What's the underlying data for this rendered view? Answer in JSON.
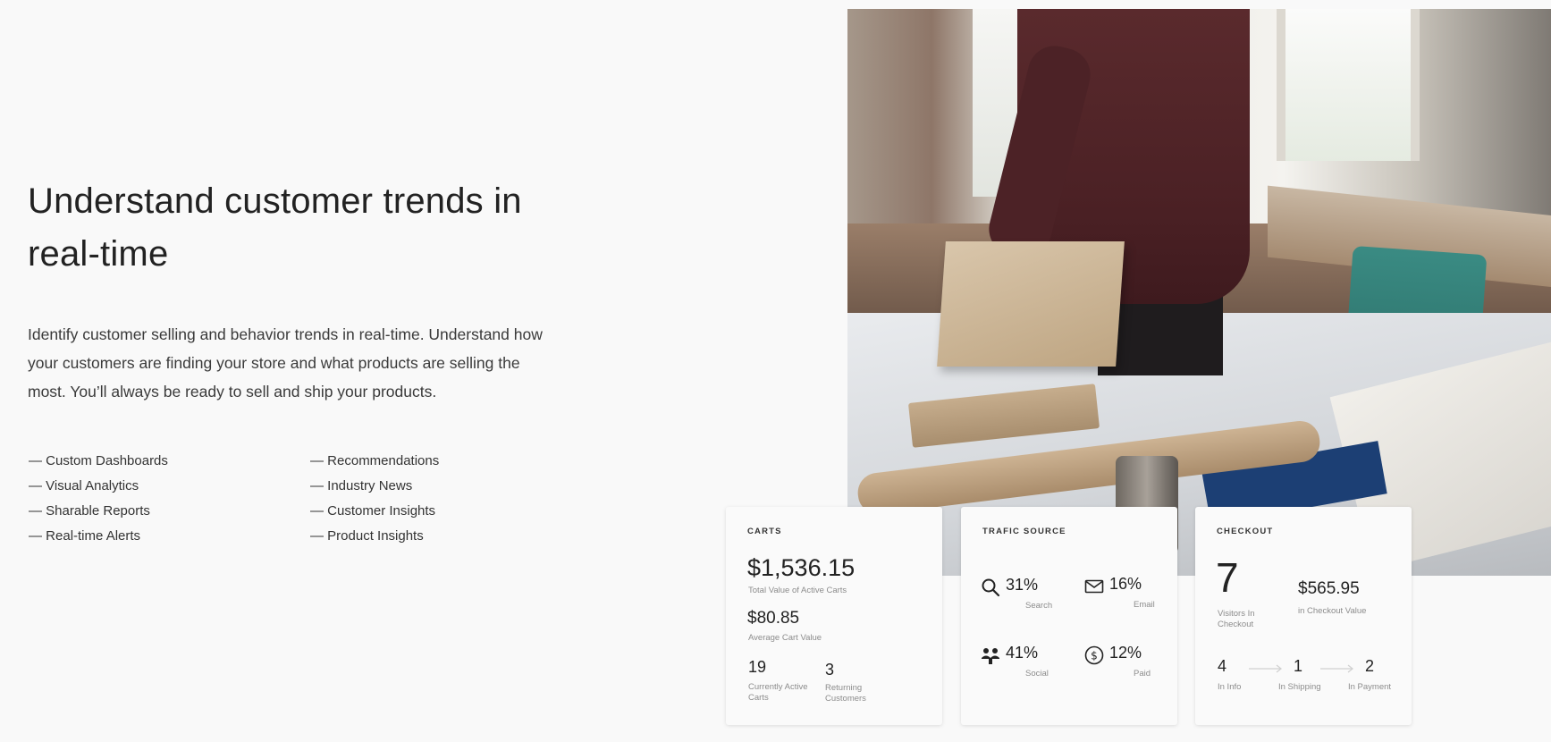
{
  "hero": {
    "title": "Understand customer trends in real-time",
    "description": "Identify customer selling and behavior trends in real-time. Understand how your customers are finding your store and what products are selling the most. You’ll always be ready to sell and ship your products."
  },
  "features": {
    "column1": [
      "Custom Dashboards",
      "Visual Analytics",
      "Sharable Reports",
      "Real-time Alerts"
    ],
    "column2": [
      "Recommendations",
      "Industry News",
      "Customer Insights",
      "Product Insights"
    ]
  },
  "cards": {
    "carts": {
      "title": "CARTS",
      "total_value": "$1,536.15",
      "total_value_label": "Total Value of Active Carts",
      "average_value": "$80.85",
      "average_value_label": "Average Cart Value",
      "active_carts": "19",
      "active_carts_label": "Currently Active Carts",
      "returning": "3",
      "returning_label": "Returning Customers"
    },
    "traffic": {
      "title": "TRAFIC SOURCE",
      "search_pct": "31%",
      "search_label": "Search",
      "email_pct": "16%",
      "email_label": "Email",
      "social_pct": "41%",
      "social_label": "Social",
      "paid_pct": "12%",
      "paid_label": "Paid"
    },
    "checkout": {
      "title": "CHECKOUT",
      "visitors": "7",
      "visitors_label": "Visitors In Checkout",
      "value": "$565.95",
      "value_label": "in Checkout Value",
      "info": "4",
      "info_label": "In Info",
      "shipping": "1",
      "shipping_label": "In Shipping",
      "payment": "2",
      "payment_label": "In Payment"
    }
  },
  "icons": {
    "search": "search-icon",
    "email": "envelope-icon",
    "social": "people-icon",
    "paid": "dollar-circle-icon",
    "arrow": "arrow-right-icon"
  }
}
